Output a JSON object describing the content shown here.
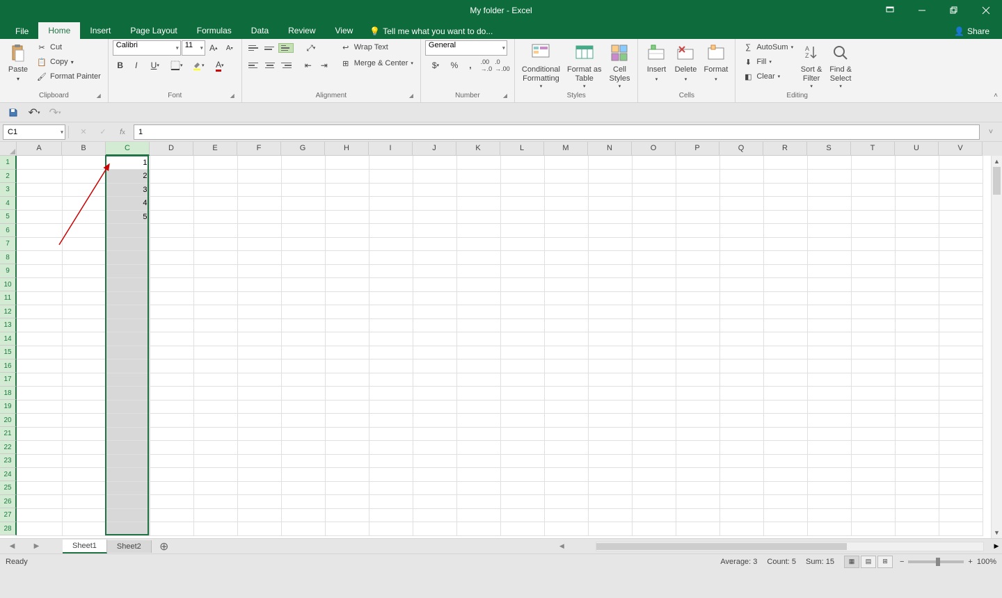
{
  "title": "My folder - Excel",
  "tabs": {
    "file": "File",
    "home": "Home",
    "insert": "Insert",
    "page_layout": "Page Layout",
    "formulas": "Formulas",
    "data": "Data",
    "review": "Review",
    "view": "View",
    "tell_me": "Tell me what you want to do..."
  },
  "share": "Share",
  "ribbon": {
    "clipboard": {
      "paste": "Paste",
      "cut": "Cut",
      "copy": "Copy",
      "format_painter": "Format Painter",
      "label": "Clipboard"
    },
    "font": {
      "name": "Calibri",
      "size": "11",
      "label": "Font"
    },
    "alignment": {
      "wrap": "Wrap Text",
      "merge": "Merge & Center",
      "label": "Alignment"
    },
    "number": {
      "format": "General",
      "label": "Number"
    },
    "styles": {
      "conditional": "Conditional\nFormatting",
      "format_table": "Format as\nTable",
      "cell_styles": "Cell\nStyles",
      "label": "Styles"
    },
    "cells": {
      "insert": "Insert",
      "delete": "Delete",
      "format": "Format",
      "label": "Cells"
    },
    "editing": {
      "autosum": "AutoSum",
      "fill": "Fill",
      "clear": "Clear",
      "sort": "Sort &\nFilter",
      "find": "Find &\nSelect",
      "label": "Editing"
    }
  },
  "name_box": "C1",
  "formula_value": "1",
  "columns": [
    "A",
    "B",
    "C",
    "D",
    "E",
    "F",
    "G",
    "H",
    "I",
    "J",
    "K",
    "L",
    "M",
    "N",
    "O",
    "P",
    "Q",
    "R",
    "S",
    "T",
    "U",
    "V"
  ],
  "rows": [
    1,
    2,
    3,
    4,
    5,
    6,
    7,
    8,
    9,
    10,
    11,
    12,
    13,
    14,
    15,
    16,
    17,
    18,
    19,
    20,
    21,
    22,
    23,
    24,
    25,
    26,
    27,
    28
  ],
  "selected_column": "C",
  "cell_data": {
    "C1": "1",
    "C2": "2",
    "C3": "3",
    "C4": "4",
    "C5": "5"
  },
  "sheets": {
    "s1": "Sheet1",
    "s2": "Sheet2"
  },
  "status": {
    "ready": "Ready",
    "average": "Average: 3",
    "count": "Count: 5",
    "sum": "Sum: 15",
    "zoom": "100%"
  }
}
